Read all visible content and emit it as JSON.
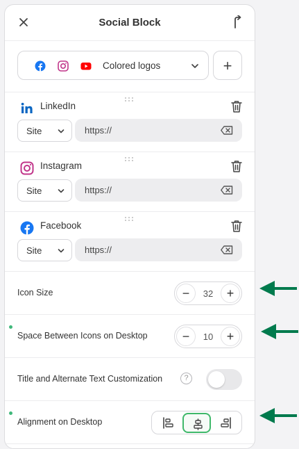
{
  "header": {
    "title": "Social Block"
  },
  "style_select": {
    "label": "Colored logos"
  },
  "social_items": [
    {
      "name": "LinkedIn",
      "site": "Site",
      "url": "https://"
    },
    {
      "name": "Instagram",
      "site": "Site",
      "url": "https://"
    },
    {
      "name": "Facebook",
      "site": "Site",
      "url": "https://"
    }
  ],
  "icon_size": {
    "label": "Icon Size",
    "value": "32"
  },
  "spacing": {
    "label": "Space Between Icons on Desktop",
    "value": "10"
  },
  "title_custom": {
    "label": "Title and Alternate Text Customization",
    "help": "?"
  },
  "alignment": {
    "label": "Alignment on Desktop",
    "options": [
      "left",
      "center",
      "right"
    ],
    "selected": "center"
  },
  "colors": {
    "accent_green": "#3fb86a",
    "arrow_green": "#007a4d",
    "linkedin": "#0a66c2",
    "instagram": "#c1358a",
    "facebook": "#1877f2",
    "youtube": "#ff0000"
  }
}
